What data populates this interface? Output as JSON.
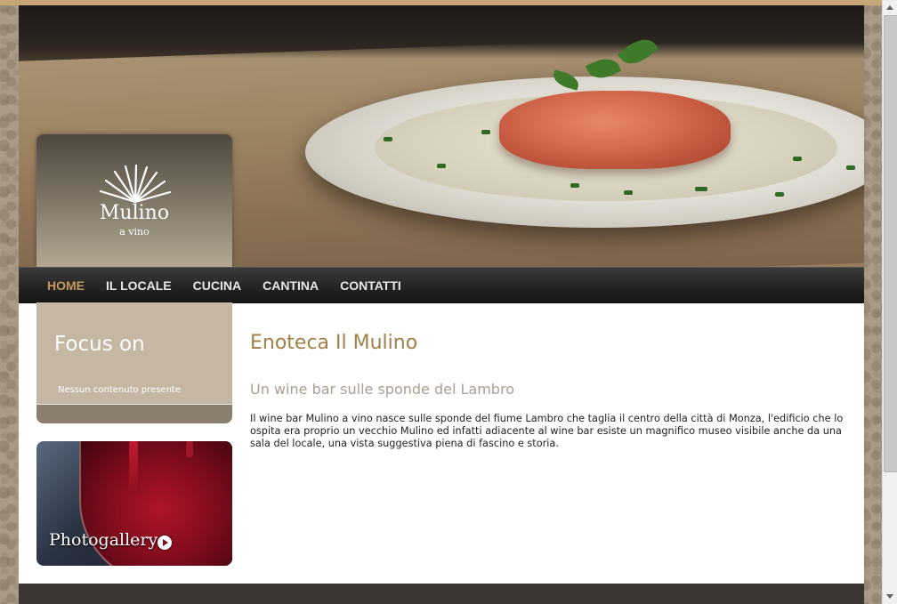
{
  "brand": {
    "name": "Mulino",
    "tagline": "a vino"
  },
  "nav": {
    "items": [
      {
        "label": "HOME",
        "active": true
      },
      {
        "label": "IL LOCALE",
        "active": false
      },
      {
        "label": "CUCINA",
        "active": false
      },
      {
        "label": "CANTINA",
        "active": false
      },
      {
        "label": "CONTATTI",
        "active": false
      }
    ]
  },
  "sidebar": {
    "focus_title": "Focus on",
    "focus_empty": "Nessun contenuto presente",
    "gallery_label": "Photogallery"
  },
  "main": {
    "title": "Enoteca Il Mulino",
    "subtitle": "Un wine bar sulle sponde del Lambro",
    "body": "Il wine bar Mulino a vino nasce sulle sponde del fiume Lambro che taglia il centro della città di Monza, l'edificio che lo ospita era proprio un vecchio Mulino ed infatti adiacente al wine bar esiste un magnifico museo visibile anche da una sala del locale, una vista suggestiva piena di fascino e storia."
  },
  "colors": {
    "accent": "#c49a5d",
    "title": "#a07f49",
    "subtitle": "#a99f93",
    "nav_bg": "#262626",
    "sidebar_box": "#c4b7a3"
  }
}
